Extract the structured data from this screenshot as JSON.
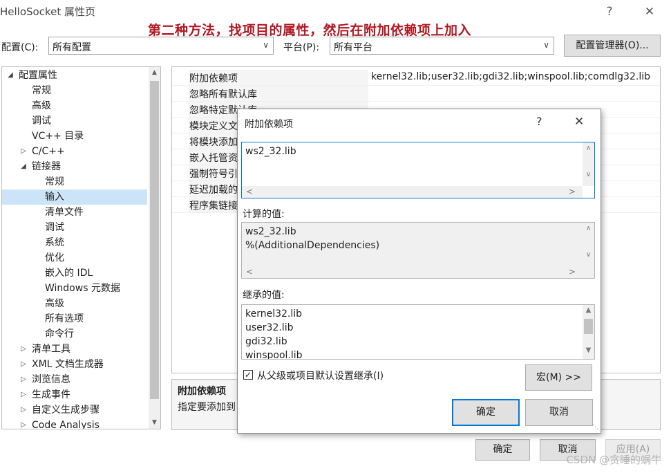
{
  "window": {
    "title": "HelloSocket 属性页",
    "help_glyph": "?",
    "close_glyph": "✕"
  },
  "annotation": "第二种方法，找项目的属性，然后在附加依赖项上加入",
  "toolbar": {
    "config_label": "配置(C):",
    "config_value": "所有配置",
    "platform_label": "平台(P):",
    "platform_value": "所有平台",
    "config_manager_label": "配置管理器(O)..."
  },
  "tree": {
    "items": [
      {
        "label": "配置属性",
        "expander": "◢"
      },
      {
        "label": "常规",
        "expander": ""
      },
      {
        "label": "高级",
        "expander": ""
      },
      {
        "label": "调试",
        "expander": ""
      },
      {
        "label": "VC++ 目录",
        "expander": ""
      },
      {
        "label": "C/C++",
        "expander": "▷"
      },
      {
        "label": "链接器",
        "expander": "◢"
      },
      {
        "label": "常规",
        "expander": ""
      },
      {
        "label": "输入",
        "expander": ""
      },
      {
        "label": "清单文件",
        "expander": ""
      },
      {
        "label": "调试",
        "expander": ""
      },
      {
        "label": "系统",
        "expander": ""
      },
      {
        "label": "优化",
        "expander": ""
      },
      {
        "label": "嵌入的 IDL",
        "expander": ""
      },
      {
        "label": "Windows 元数据",
        "expander": ""
      },
      {
        "label": "高级",
        "expander": ""
      },
      {
        "label": "所有选项",
        "expander": ""
      },
      {
        "label": "命令行",
        "expander": ""
      },
      {
        "label": "清单工具",
        "expander": "▷"
      },
      {
        "label": "XML 文档生成器",
        "expander": "▷"
      },
      {
        "label": "浏览信息",
        "expander": "▷"
      },
      {
        "label": "生成事件",
        "expander": "▷"
      },
      {
        "label": "自定义生成步骤",
        "expander": "▷"
      },
      {
        "label": "Code Analysis",
        "expander": "▷"
      }
    ]
  },
  "properties": [
    {
      "name": "附加依赖项",
      "value": "kernel32.lib;user32.lib;gdi32.lib;winspool.lib;comdlg32.lib"
    },
    {
      "name": "忽略所有默认库",
      "value": ""
    },
    {
      "name": "忽略特定默认库",
      "value": ""
    },
    {
      "name": "模块定义文",
      "value": ""
    },
    {
      "name": "将模块添加",
      "value": ""
    },
    {
      "name": "嵌入托管资",
      "value": ""
    },
    {
      "name": "强制符号引",
      "value": ""
    },
    {
      "name": "延迟加载的",
      "value": ""
    },
    {
      "name": "程序集链接",
      "value": ""
    }
  ],
  "description": {
    "title": "附加依赖项",
    "text": "指定要添加到"
  },
  "main_buttons": {
    "ok": "确定",
    "cancel": "取消",
    "apply": "应用(A)"
  },
  "dialog": {
    "title": "附加依赖项",
    "help_glyph": "?",
    "close_glyph": "✕",
    "input_lines": [
      "ws2_32.lib"
    ],
    "computed_label": "计算的值:",
    "computed_lines": [
      "ws2_32.lib",
      "%(AdditionalDependencies)"
    ],
    "inherited_label": "继承的值:",
    "inherited_lines": [
      "kernel32.lib",
      "user32.lib",
      "gdi32.lib",
      "winspool.lib"
    ],
    "inherit_checkbox_label": "从父级或项目默认设置继承(I)",
    "inherit_checked": true,
    "macro_button": "宏(M) >>",
    "ok": "确定",
    "cancel": "取消"
  },
  "watermark": "CSDN @贪睡的蜗牛",
  "colors": {
    "annotation": "#b11822",
    "selection": "#cce4f7",
    "focus": "#0078d7"
  }
}
